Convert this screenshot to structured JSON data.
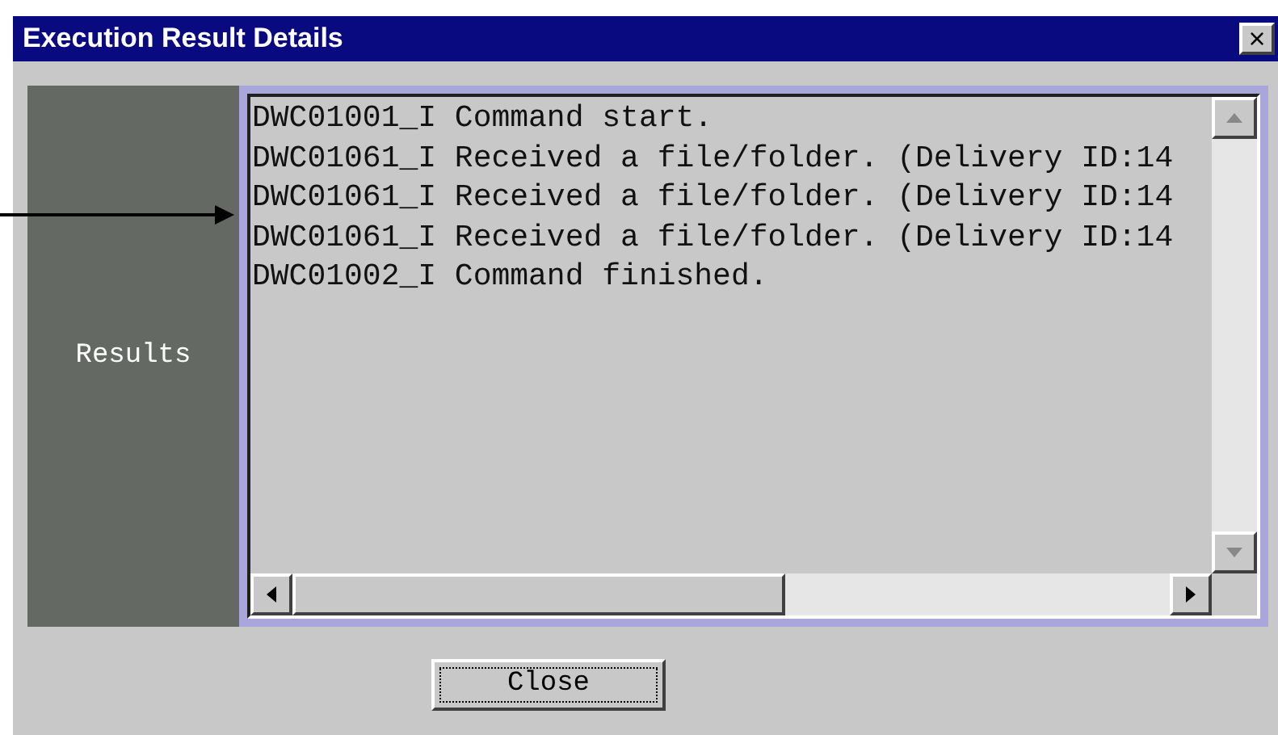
{
  "window": {
    "title": "Execution Result Details",
    "close": "×"
  },
  "side_label": "Results",
  "log_lines": [
    "DWC01001_I Command start.",
    "DWC01061_I Received a file/folder. (Delivery ID:14",
    "DWC01061_I Received a file/folder. (Delivery ID:14",
    "DWC01061_I Received a file/folder. (Delivery ID:14",
    "DWC01002_I Command finished."
  ],
  "buttons": [
    "Close"
  ]
}
